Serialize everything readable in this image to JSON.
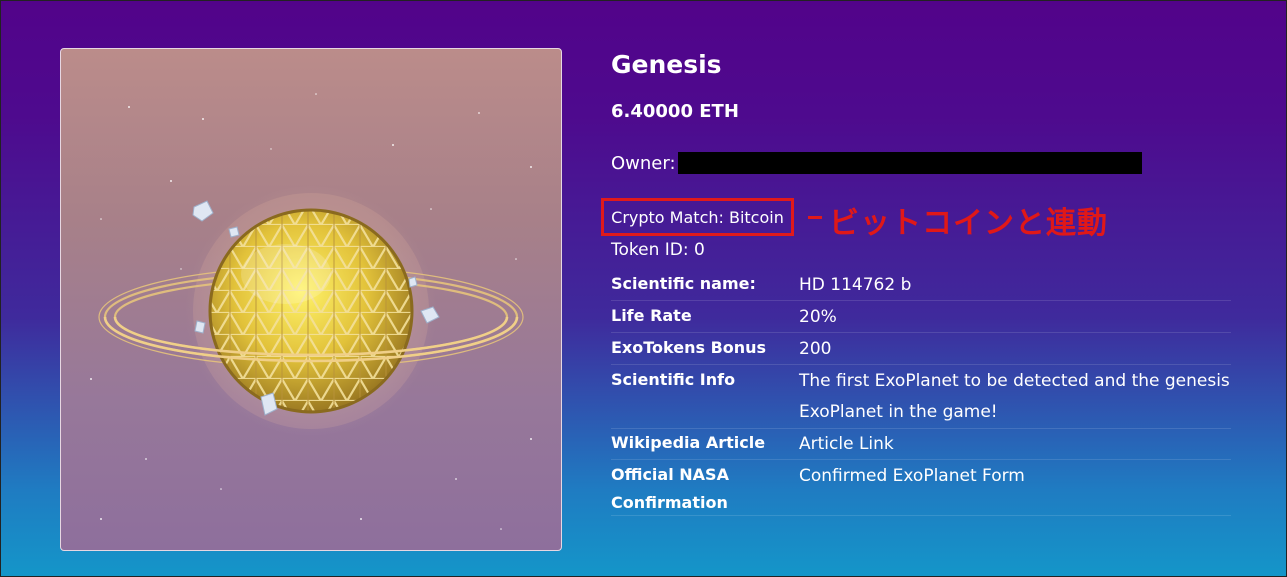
{
  "item": {
    "title": "Genesis",
    "price": "6.40000 ETH",
    "owner_label": "Owner:",
    "crypto_match": "Crypto Match: Bitcoin",
    "annotation": "ビットコインと連動",
    "token_id": "Token ID: 0"
  },
  "details": [
    {
      "label": "Scientific name:",
      "value": "HD 114762 b"
    },
    {
      "label": "Life Rate",
      "value": "20%"
    },
    {
      "label": "ExoTokens Bonus",
      "value": "200"
    },
    {
      "label": "Scientific Info",
      "value": "The first ExoPlanet to be detected and the genesis ExoPlanet in the game!"
    },
    {
      "label": "Wikipedia Article",
      "value": "Article Link"
    },
    {
      "label": "Official NASA Confirmation",
      "value": "Confirmed ExoPlanet Form"
    }
  ],
  "colors": {
    "highlight": "#e11a1a",
    "planet_gold": "#d8b24a"
  }
}
